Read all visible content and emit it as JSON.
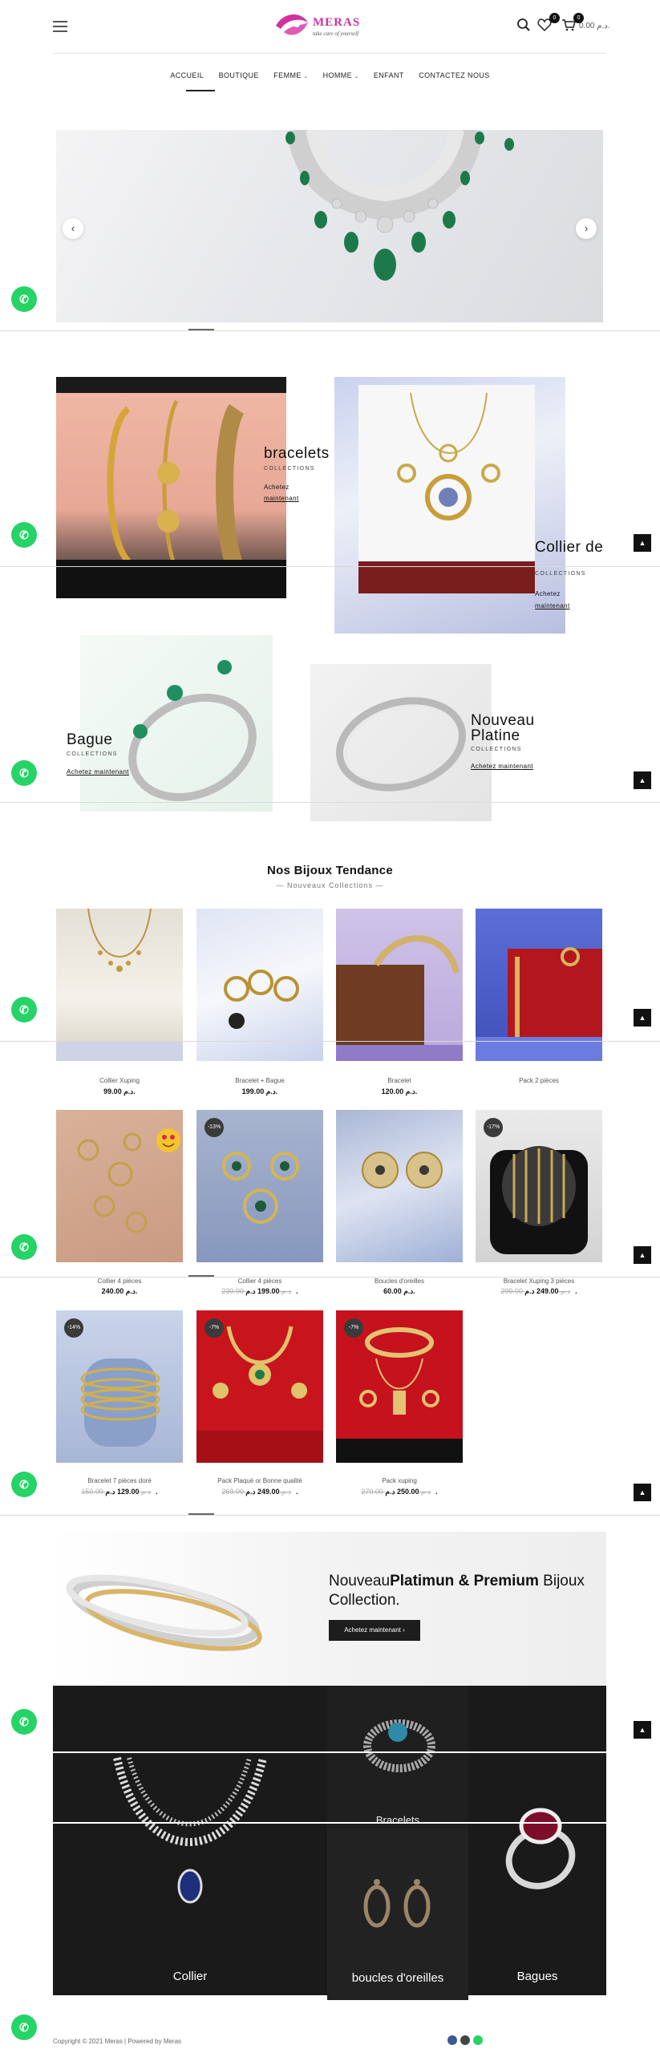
{
  "brand": {
    "name": "MERAS",
    "tagline": "take care of yourself",
    "colors": {
      "brand": "#d0339f",
      "accent": "#111111",
      "whatsapp": "#25d366"
    }
  },
  "header": {
    "menu_icon": "hamburger-icon",
    "search_icon": "search-icon",
    "wishlist": {
      "icon": "heart-icon",
      "count": "0"
    },
    "cart": {
      "icon": "cart-icon",
      "count": "0",
      "total": "0.00 د.م."
    }
  },
  "nav": {
    "items": [
      {
        "label": "ACCUEIL",
        "active": true
      },
      {
        "label": "BOUTIQUE"
      },
      {
        "label": "FEMME"
      },
      {
        "label": "HOMME"
      },
      {
        "label": "ENFANT"
      },
      {
        "label": "CONTACTEZ NOUS"
      }
    ]
  },
  "hero": {
    "prev_icon": "chevron-left-icon",
    "next_icon": "chevron-right-icon"
  },
  "collections": [
    {
      "title": "bracelets",
      "sub": "COLLECTIONS",
      "link1": "Achetez",
      "link2": "maintenant"
    },
    {
      "title": "Collier de",
      "sub": "COLLECTIONS",
      "link1": "Achetez",
      "link2": "maintenant"
    },
    {
      "title": "Bague",
      "sub": "COLLECTIONS",
      "link": "Achetez maintenant"
    },
    {
      "title1": "Nouveau",
      "title2": "Platine",
      "sub": "COLLECTIONS",
      "link": "Achetez maintenant"
    }
  ],
  "trending": {
    "title": "Nos Bijoux Tendance",
    "subtitle": "— Nouveaux Collections —"
  },
  "products": [
    {
      "name": "Collier Xuping",
      "price": "99.00 د.م."
    },
    {
      "name": "Bracelet + Bague",
      "price": "199.00 د.م."
    },
    {
      "name": "Bracelet",
      "price": "120.00 د.م."
    },
    {
      "name": "Pack 2 pièces",
      "price": ""
    },
    {
      "name": "Collier 4 pièces",
      "price": "240.00 د.م."
    },
    {
      "name": "Collier 4 pièces",
      "old": "230.00 د.م.",
      "price": "199.00 د.م.",
      "badge": "-13%"
    },
    {
      "name": "Boucles d'oreilles",
      "price": "60.00 د.م."
    },
    {
      "name": "Bracelet Xuping 3 pièces",
      "old": "299.00 د.م.",
      "price": "249.00 د.م.",
      "badge": "-17%"
    },
    {
      "name": "Bracelet 7 pièces doré",
      "old": "150.00 د.م.",
      "price": "129.00 د.م.",
      "badge": "-14%"
    },
    {
      "name": "Pack Plaqué or Bonne qualité",
      "old": "269.00 د.م.",
      "price": "249.00 د.م.",
      "badge": "-7%"
    },
    {
      "name": "Pack xuping",
      "old": "270.00 د.م.",
      "price": "250.00 د.م.",
      "badge": "-7%"
    }
  ],
  "promo": {
    "text_a": "Nouveau",
    "text_b": "Platimun & Premium",
    "text_c": " Bijoux Collection.",
    "button": "Achetez maintenant"
  },
  "categories": {
    "collier": "Collier",
    "bracelets": "Bracelets",
    "boucles": "boucles d'oreilles",
    "bagues": "Bagues"
  },
  "footer": {
    "copyright": "Copyright © 2021 Meras | Powered by Meras"
  }
}
